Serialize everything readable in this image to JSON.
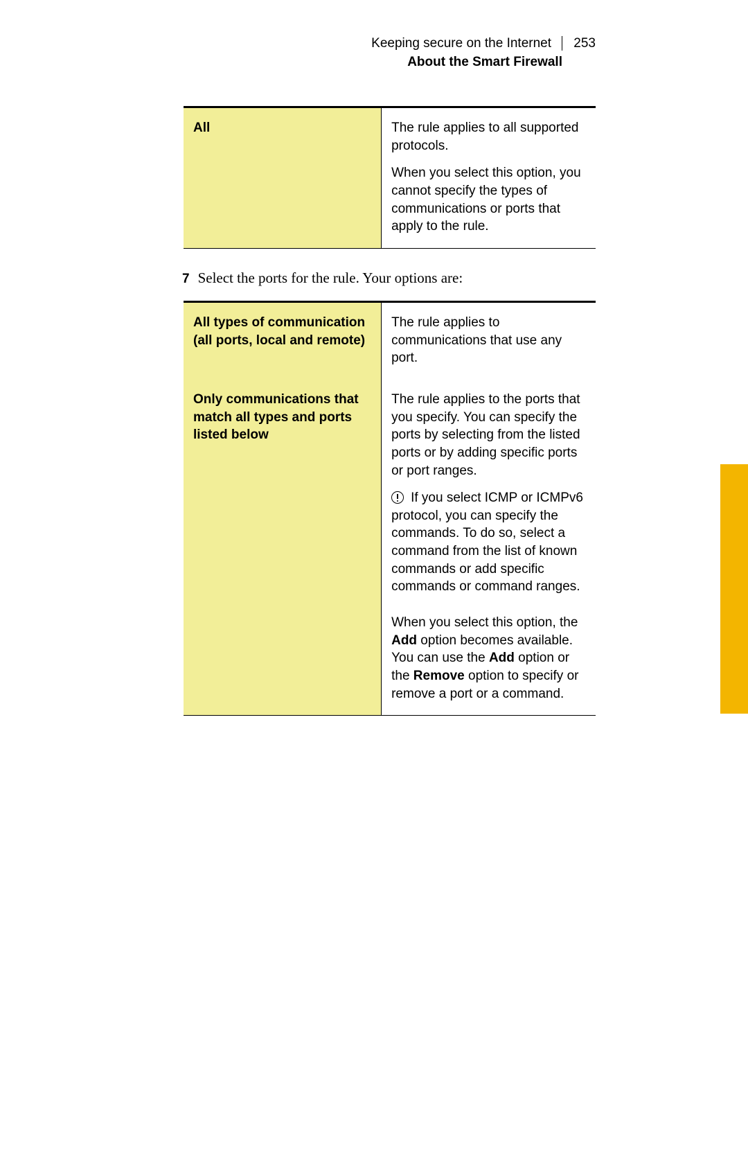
{
  "header": {
    "chapter_title": "Keeping secure on the Internet",
    "page_number": "253",
    "section_title": "About the Smart Firewall"
  },
  "table1": {
    "row1": {
      "label": "All",
      "desc_p1": "The rule applies to all supported protocols.",
      "desc_p2": "When you select this option, you cannot specify the types of communications or ports that apply to the rule."
    }
  },
  "step": {
    "number": "7",
    "text": "Select the ports for the rule. Your options are:"
  },
  "table2": {
    "row1": {
      "label": "All types of communication (all ports, local and remote)",
      "desc_p1": "The rule applies to communications that use any port."
    },
    "row2": {
      "label": "Only communications that match all types and ports listed below",
      "desc_p1": "The rule applies to the ports that you specify. You can specify the ports by selecting from the listed ports or by adding specific ports or port ranges.",
      "note_lead": "If you select ICMP",
      "note_rest": "or ICMPv6 protocol, you can specify the commands. To do so, select a command from the list of known commands or add specific commands or command ranges.",
      "desc_p3_a": "When you select this option, the ",
      "desc_p3_b": "Add",
      "desc_p3_c": " option becomes available. You can use the ",
      "desc_p3_d": "Add",
      "desc_p3_e": " option or the ",
      "desc_p3_f": "Remove",
      "desc_p3_g": " option to specify or remove a port or a command."
    }
  }
}
